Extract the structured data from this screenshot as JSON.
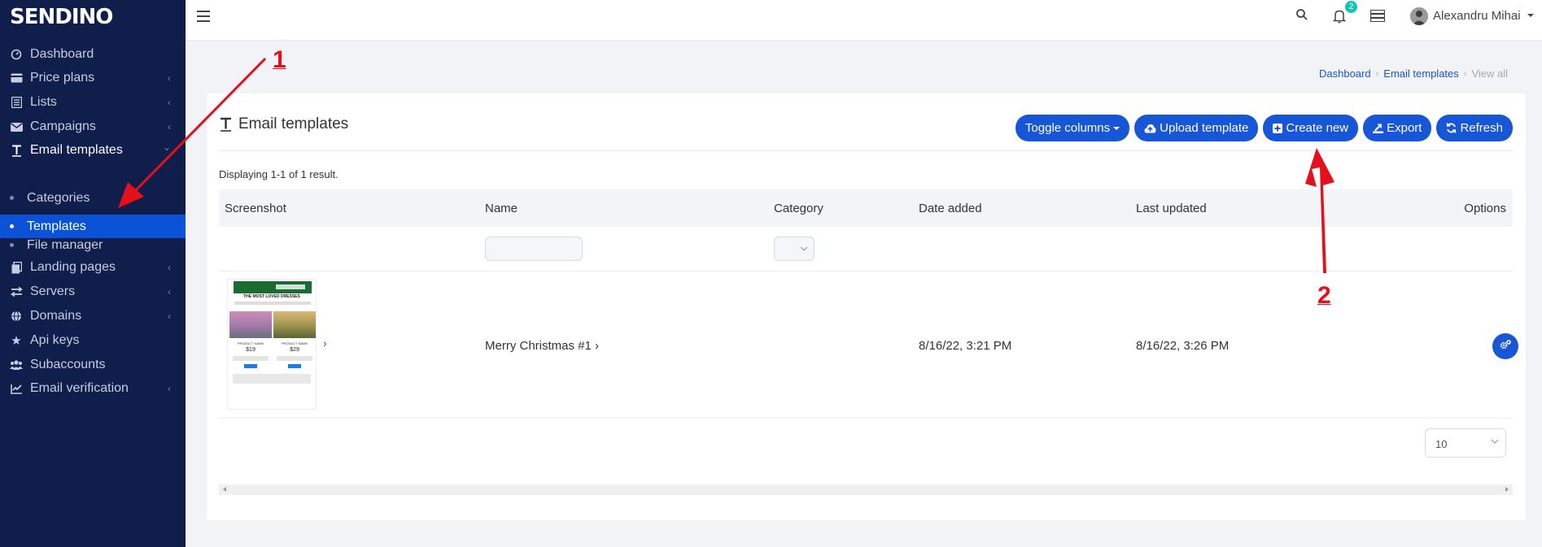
{
  "brand": {
    "logo": "SENDINO"
  },
  "sidebar": {
    "items": [
      {
        "label": "Dashboard",
        "icon": "dashboard-icon",
        "chevron": ""
      },
      {
        "label": "Price plans",
        "icon": "credit-card-icon",
        "chevron": "‹"
      },
      {
        "label": "Lists",
        "icon": "list-icon",
        "chevron": "‹"
      },
      {
        "label": "Campaigns",
        "icon": "envelope-icon",
        "chevron": "‹"
      },
      {
        "label": "Email templates",
        "icon": "text-icon",
        "chevron": "⌄"
      },
      {
        "label": "Landing pages",
        "icon": "pages-icon",
        "chevron": "‹"
      },
      {
        "label": "Servers",
        "icon": "exchange-icon",
        "chevron": "‹"
      },
      {
        "label": "Domains",
        "icon": "globe-icon",
        "chevron": "‹"
      },
      {
        "label": "Api keys",
        "icon": "star-icon",
        "chevron": ""
      },
      {
        "label": "Subaccounts",
        "icon": "users-icon",
        "chevron": ""
      },
      {
        "label": "Email verification",
        "icon": "check-chart-icon",
        "chevron": "‹"
      }
    ],
    "sub_items": [
      {
        "label": "Categories"
      },
      {
        "label": "Templates"
      },
      {
        "label": "File manager"
      }
    ]
  },
  "topbar": {
    "notifications_count": "2",
    "user_name": "Alexandru Mihai"
  },
  "breadcrumb": {
    "items": [
      "Dashboard",
      "Email templates"
    ],
    "current": "View all"
  },
  "card": {
    "title": "Email templates",
    "buttons": {
      "toggle_columns": "Toggle columns",
      "upload_template": "Upload template",
      "create_new": "Create new",
      "export": "Export",
      "refresh": "Refresh"
    },
    "summary": "Displaying 1-1 of 1 result."
  },
  "table": {
    "headers": {
      "screenshot": "Screenshot",
      "name": "Name",
      "category": "Category",
      "date_added": "Date added",
      "last_updated": "Last updated",
      "options": "Options"
    },
    "rows": [
      {
        "name": "Merry Christmas #1",
        "category": "",
        "date_added": "8/16/22, 3:21 PM",
        "last_updated": "8/16/22, 3:26 PM",
        "thumb": {
          "headline": "THE MOST LOVED DRESSES",
          "product_a": "PRODUCT NAME",
          "price_a": "$19",
          "product_b": "PRODUCT NAME",
          "price_b": "$29"
        }
      }
    ]
  },
  "pager": {
    "page_size": "10"
  },
  "annotations": {
    "one": "1",
    "two": "2"
  },
  "colors": {
    "sidebar": "#0f1e4b",
    "primary": "#1756d6",
    "annotation": "#e5101b"
  }
}
